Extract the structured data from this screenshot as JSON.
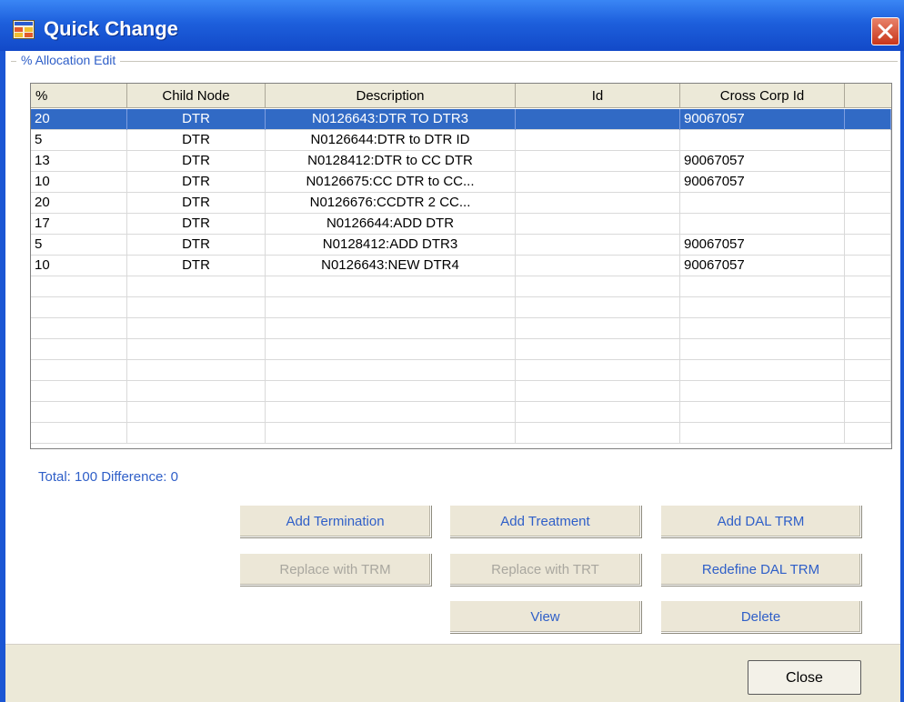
{
  "window": {
    "title": "Quick Change"
  },
  "group": {
    "legend": "% Allocation Edit"
  },
  "grid": {
    "columns": [
      "%",
      "Child Node",
      "Description",
      "Id",
      "Cross Corp Id"
    ],
    "rows": [
      {
        "pct": "20",
        "child": "DTR",
        "desc": "N0126643:DTR TO DTR3",
        "id": "",
        "ccid": "90067057"
      },
      {
        "pct": "5",
        "child": "DTR",
        "desc": "N0126644:DTR to DTR ID",
        "id": "",
        "ccid": ""
      },
      {
        "pct": "13",
        "child": "DTR",
        "desc": "N0128412:DTR to CC DTR",
        "id": "",
        "ccid": "90067057"
      },
      {
        "pct": "10",
        "child": "DTR",
        "desc": "N0126675:CC DTR to CC...",
        "id": "",
        "ccid": "90067057"
      },
      {
        "pct": "20",
        "child": "DTR",
        "desc": "N0126676:CCDTR 2 CC...",
        "id": "",
        "ccid": ""
      },
      {
        "pct": "17",
        "child": "DTR",
        "desc": "N0126644:ADD DTR",
        "id": "",
        "ccid": ""
      },
      {
        "pct": "5",
        "child": "DTR",
        "desc": "N0128412:ADD DTR3",
        "id": "",
        "ccid": "90067057"
      },
      {
        "pct": "10",
        "child": "DTR",
        "desc": "N0126643:NEW DTR4",
        "id": "",
        "ccid": "90067057"
      }
    ],
    "selected_row": 0
  },
  "summary": {
    "total_text": "Total: 100 Difference: 0"
  },
  "buttons": {
    "add_termination": "Add Termination",
    "add_treatment": "Add Treatment",
    "add_dal_trm": "Add DAL TRM",
    "replace_trm": "Replace with TRM",
    "replace_trt": "Replace with TRT",
    "redefine_dal_trm": "Redefine DAL TRM",
    "view": "View",
    "delete": "Delete",
    "close": "Close"
  },
  "colors": {
    "titlebar": "#1d5fdc",
    "selection": "#316ac5",
    "link_text": "#2f5fc8",
    "button_face": "#ece7d7"
  },
  "icons": {
    "app": "grid-app-icon",
    "close": "close-x-icon"
  }
}
